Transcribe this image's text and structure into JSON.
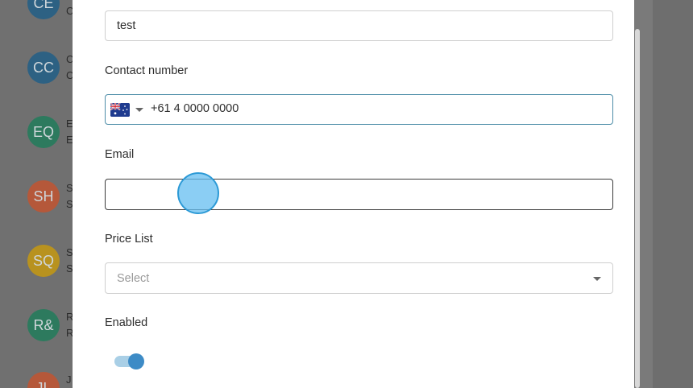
{
  "background_list": {
    "items": [
      {
        "initials": "CE",
        "color": "#2d6183",
        "line1": "C",
        "line2": "C"
      },
      {
        "initials": "CC",
        "color": "#2d6183",
        "line1": "C",
        "line2": "C"
      },
      {
        "initials": "EQ",
        "color": "#2d7a5e",
        "line1": "E",
        "line2": "E"
      },
      {
        "initials": "SH",
        "color": "#b5583a",
        "line1": "S",
        "line2": "S"
      },
      {
        "initials": "SQ",
        "color": "#b8921f",
        "line1": "S",
        "line2": "S"
      },
      {
        "initials": "R&",
        "color": "#2d7a5e",
        "line1": "R",
        "line2": "R"
      },
      {
        "initials": "JL",
        "color": "#b5583a",
        "line1": "J",
        "line2": ""
      }
    ]
  },
  "form": {
    "name_field": {
      "value": "test"
    },
    "contact": {
      "label": "Contact number",
      "country_flag": "australia-flag-icon",
      "value": "+61 4 0000 0000"
    },
    "email": {
      "label": "Email",
      "value": ""
    },
    "price_list": {
      "label": "Price List",
      "placeholder": "Select"
    },
    "enabled": {
      "label": "Enabled",
      "state": "on"
    }
  },
  "colors": {
    "focus_border": "#4d8da8",
    "toggle_on": "#3d8bc6",
    "toggle_track": "#a9cfe6"
  }
}
